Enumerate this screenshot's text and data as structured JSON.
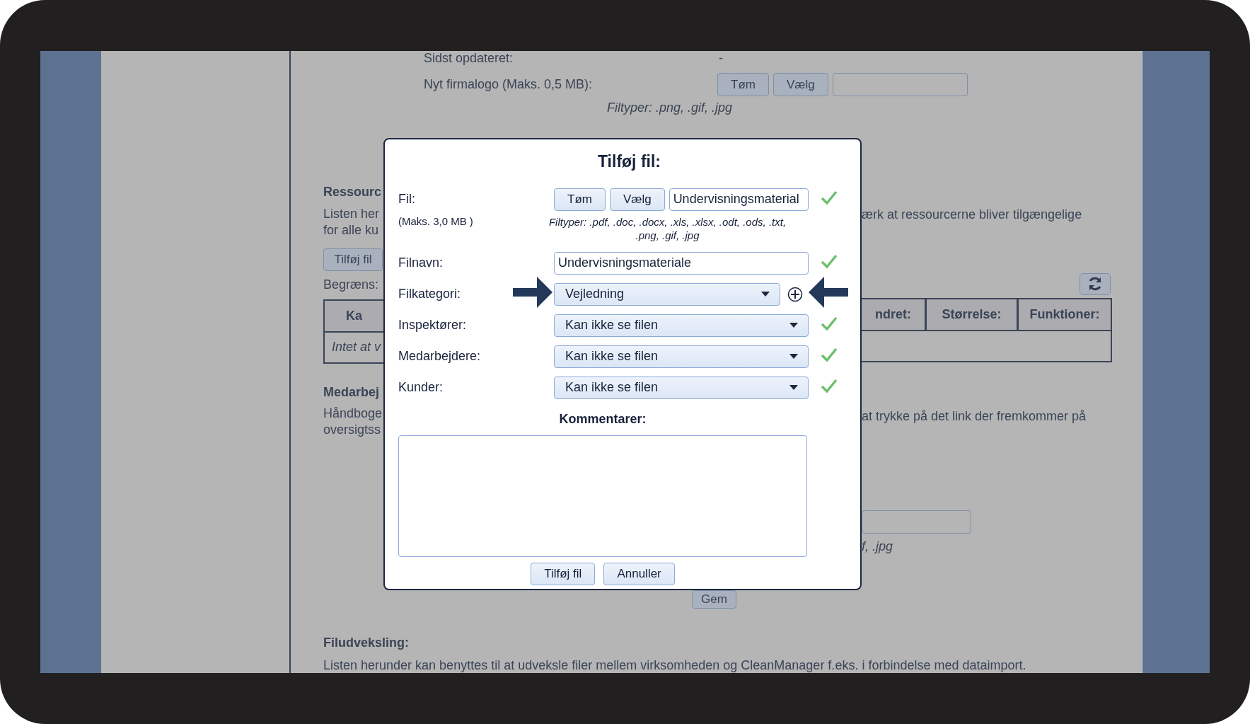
{
  "page": {
    "updated": {
      "label": "Sidst opdateret:",
      "value": "-"
    },
    "logo": {
      "label": "Nyt firmalogo (Maks. 0,5 MB):",
      "buttons": [
        "Tøm",
        "Vælg"
      ],
      "filetypes": "Filtyper: .png, .gif, .jpg"
    },
    "left": {
      "heading": "Ressourc",
      "lines": [
        "Listen her",
        "for alle ku"
      ],
      "button": "Tilføj fil",
      "filter_label": "Begræns:",
      "table_header": "Ka",
      "table_empty": "Intet at v",
      "heading2": "Medarbej",
      "lines2": [
        "Håndboge",
        "oversigtss"
      ]
    },
    "right": {
      "text": "ærk at ressourcerne bliver tilgængelige",
      "table_headers": [
        "ndret:",
        "Størrelse:",
        "Funktioner:"
      ],
      "text2": "at trykke på det link der fremkommer på",
      "filetypes": "f, .jpg"
    },
    "save_button": "Gem",
    "section": {
      "heading": "Filudveksling:",
      "text": "Listen herunder kan benyttes til at udveksle filer mellem virksomheden og CleanManager f.eks. i forbindelse med dataimport."
    }
  },
  "dialog": {
    "title": "Tilføj fil:",
    "file": {
      "label": "Fil:",
      "max": "(Maks. 3,0 MB )",
      "buttons": [
        "Tøm",
        "Vælg"
      ],
      "value": "Undervisningsmaterial",
      "valid": true,
      "filetypes": "Filtyper: .pdf, .doc, .docx, .xls, .xlsx, .odt, .ods, .txt, .png, .gif, .jpg"
    },
    "fields": [
      {
        "kind": "text",
        "label": "Filnavn:",
        "value": "Undervisningsmateriale",
        "valid": true,
        "add_button": false,
        "arrows": false
      },
      {
        "kind": "select",
        "label": "Filkategori:",
        "value": "Vejledning",
        "valid": false,
        "add_button": true,
        "arrows": true
      },
      {
        "kind": "select",
        "label": "Inspektører:",
        "value": "Kan ikke se filen",
        "valid": true,
        "add_button": false,
        "arrows": false
      },
      {
        "kind": "select",
        "label": "Medarbejdere:",
        "value": "Kan ikke se filen",
        "valid": true,
        "add_button": false,
        "arrows": false
      },
      {
        "kind": "select",
        "label": "Kunder:",
        "value": "Kan ikke se filen",
        "valid": true,
        "add_button": false,
        "arrows": false
      }
    ],
    "comments_label": "Kommentarer:",
    "buttons": [
      "Tilføj fil",
      "Annuller"
    ]
  }
}
